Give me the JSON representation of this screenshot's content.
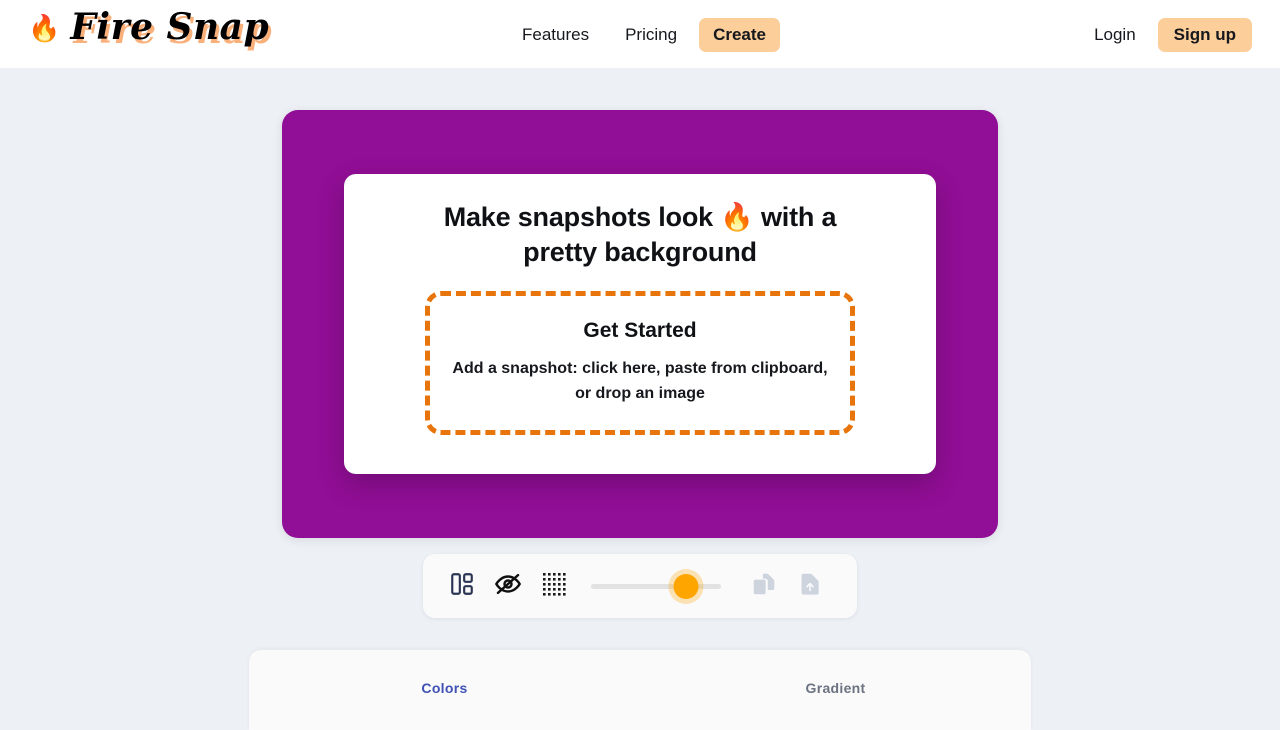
{
  "header": {
    "brand": {
      "flame_icon": "🔥",
      "name": "Fire Snap"
    },
    "nav": [
      {
        "label": "Features",
        "style": "plain"
      },
      {
        "label": "Pricing",
        "style": "plain"
      },
      {
        "label": "Create",
        "style": "pill"
      }
    ],
    "account": [
      {
        "label": "Login",
        "style": "plain"
      },
      {
        "label": "Sign up",
        "style": "pill"
      }
    ]
  },
  "editor": {
    "background_color": "#910e96",
    "snapshot": {
      "headline": "Make snapshots look 🔥 with a pretty background",
      "dropzone": {
        "title": "Get Started",
        "subtitle": "Add a snapshot: click here, paste from clipboard, or drop an image",
        "border_color": "#e8750b"
      }
    }
  },
  "toolbar": {
    "items": [
      {
        "name": "layout-icon",
        "state": "enabled",
        "color": "#2b3553"
      },
      {
        "name": "eye-off-icon",
        "state": "enabled",
        "color": "#101010"
      },
      {
        "name": "dot-grid-icon",
        "state": "enabled",
        "color": "#1a1a1a"
      }
    ],
    "slider": {
      "name": "padding-slider",
      "value_percent": 73,
      "track_color": "#e2e2e2",
      "thumb_color": "#ffa500"
    },
    "actions": [
      {
        "name": "copy-icon",
        "state": "disabled",
        "color": "#ced4de"
      },
      {
        "name": "export-icon",
        "state": "disabled",
        "color": "#ced4de"
      }
    ]
  },
  "tabs": {
    "active_color": "#3f51b5",
    "items": [
      {
        "label": "Colors",
        "active": true
      },
      {
        "label": "Gradient",
        "active": false
      }
    ]
  }
}
